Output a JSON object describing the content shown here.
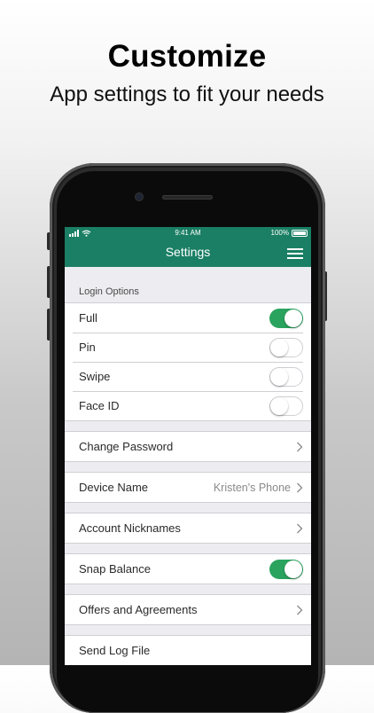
{
  "hero": {
    "title": "Customize",
    "subtitle": "App settings to fit your needs"
  },
  "status_bar": {
    "time": "9:41 AM",
    "battery": "100%"
  },
  "nav": {
    "title": "Settings",
    "menu_icon": "hamburger-menu-icon"
  },
  "login_options": {
    "header": "Login Options",
    "items": [
      {
        "label": "Full",
        "enabled": true
      },
      {
        "label": "Pin",
        "enabled": false
      },
      {
        "label": "Swipe",
        "enabled": false
      },
      {
        "label": "Face ID",
        "enabled": false
      }
    ]
  },
  "settings": {
    "change_password": "Change Password",
    "device_name": {
      "label": "Device Name",
      "value": "Kristen's Phone"
    },
    "account_nicknames": "Account Nicknames",
    "snap_balance": {
      "label": "Snap Balance",
      "enabled": true
    },
    "offers": "Offers and Agreements",
    "send_log": "Send Log File"
  },
  "colors": {
    "brand_green": "#1a7f64",
    "toggle_on": "#2aa35e"
  }
}
